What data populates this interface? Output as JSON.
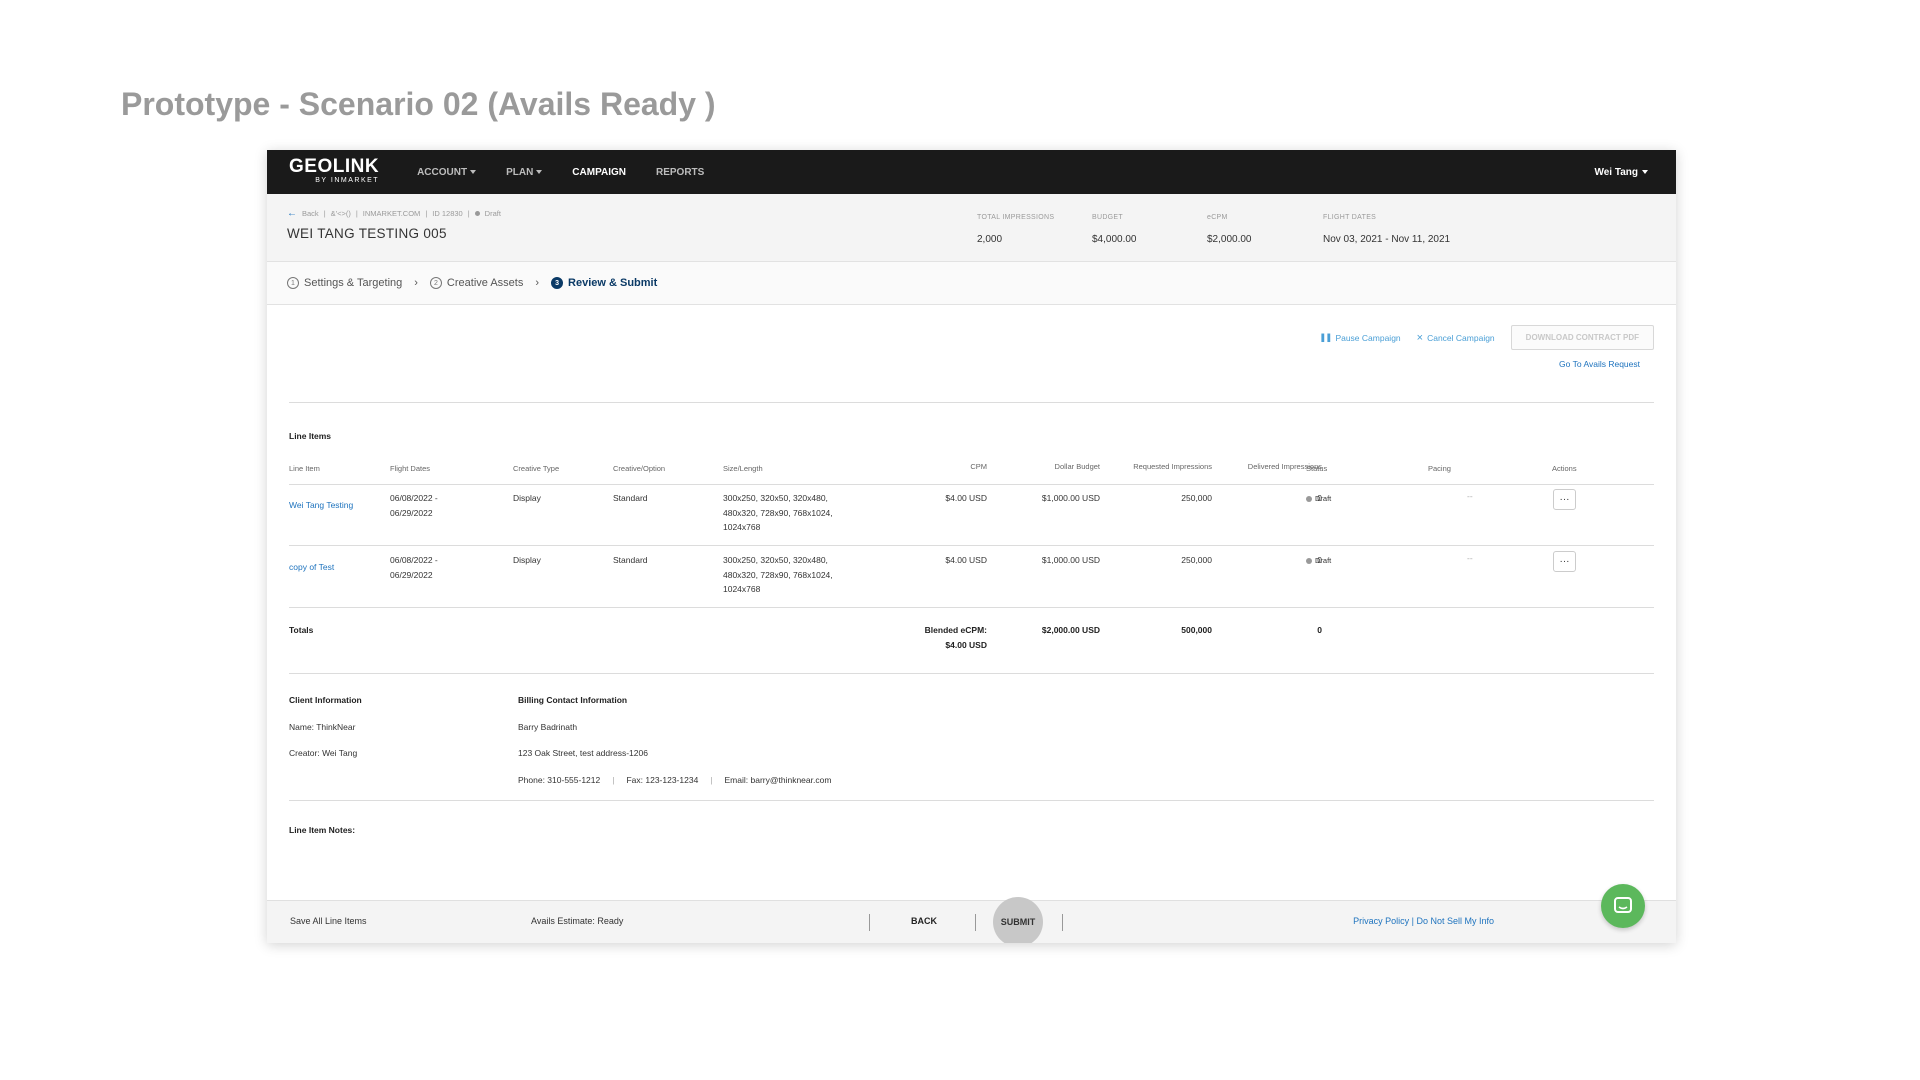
{
  "page_title": "Prototype - Scenario 02 (Avails Ready )",
  "nav": {
    "logo_main": "GEOLINK",
    "logo_sub": "BY INMARKET",
    "items": [
      "ACCOUNT",
      "PLAN",
      "CAMPAIGN",
      "REPORTS"
    ],
    "user": "Wei Tang"
  },
  "header": {
    "breadcrumb": [
      "Back",
      "&'<>()",
      "INMARKET.COM",
      "ID 12830",
      "Draft"
    ],
    "campaign_name": "WEI TANG TESTING 005",
    "stats": [
      {
        "label": "TOTAL IMPRESSIONS",
        "value": "2,000"
      },
      {
        "label": "BUDGET",
        "value": "$4,000.00"
      },
      {
        "label": "eCPM",
        "value": "$2,000.00"
      },
      {
        "label": "FLIGHT DATES",
        "value": "Nov 03, 2021 - Nov 11, 2021"
      }
    ]
  },
  "steps": [
    {
      "num": "1",
      "label": "Settings & Targeting"
    },
    {
      "num": "2",
      "label": "Creative Assets"
    },
    {
      "num": "3",
      "label": "Review & Submit"
    }
  ],
  "top_actions": {
    "pause": "Pause Campaign",
    "cancel": "Cancel Campaign",
    "download": "DOWNLOAD CONTRACT PDF",
    "goto_avails": "Go To Avails Request"
  },
  "line_items": {
    "section_title": "Line Items",
    "columns": [
      "Line Item",
      "Flight Dates",
      "Creative Type",
      "Creative/Option",
      "Size/Length",
      "CPM",
      "Dollar Budget",
      "Requested Impressions",
      "Delivered Impressions",
      "Status",
      "Pacing",
      "Actions"
    ],
    "rows": [
      {
        "name": "Wei Tang Testing",
        "flight_1": "06/08/2022 -",
        "flight_2": "06/29/2022",
        "creative_type": "Display",
        "creative_option": "Standard",
        "size_1": "300x250, 320x50, 320x480,",
        "size_2": "480x320, 728x90, 768x1024,",
        "size_3": "1024x768",
        "cpm": "$4.00 USD",
        "budget": "$1,000.00 USD",
        "requested": "250,000",
        "delivered": "0",
        "status": "Draft",
        "pacing": "--",
        "more": "···"
      },
      {
        "name": "copy of Test",
        "flight_1": "06/08/2022 -",
        "flight_2": "06/29/2022",
        "creative_type": "Display",
        "creative_option": "Standard",
        "size_1": "300x250, 320x50, 320x480,",
        "size_2": "480x320, 728x90, 768x1024,",
        "size_3": "1024x768",
        "cpm": "$4.00 USD",
        "budget": "$1,000.00 USD",
        "requested": "250,000",
        "delivered": "0",
        "status": "Draft",
        "pacing": "--",
        "more": "···"
      }
    ],
    "totals": {
      "label": "Totals",
      "blended_label": "Blended eCPM:",
      "blended_value": "$4.00 USD",
      "budget": "$2,000.00 USD",
      "requested": "500,000",
      "delivered": "0"
    }
  },
  "client_info": {
    "title": "Client Information",
    "name": "Name: ThinkNear",
    "creator": "Creator: Wei Tang"
  },
  "billing": {
    "title": "Billing Contact Information",
    "contact": "Barry Badrinath",
    "address": "123 Oak Street, test address-1206",
    "phone": "Phone: 310-555-1212",
    "fax": "Fax: 123-123-1234",
    "email": "Email: barry@thinknear.com"
  },
  "notes_label": "Line Item Notes:",
  "footer": {
    "save_all": "Save All Line Items",
    "avails_estimate": "Avails Estimate: Ready",
    "back": "BACK",
    "submit": "SUBMIT",
    "privacy": "Privacy Policy | Do Not Sell My Info"
  },
  "colors": {
    "nav_bg": "#1a1a1a",
    "link": "#1e73be",
    "active_step": "#0b3a66",
    "chat": "#5cb85c"
  }
}
